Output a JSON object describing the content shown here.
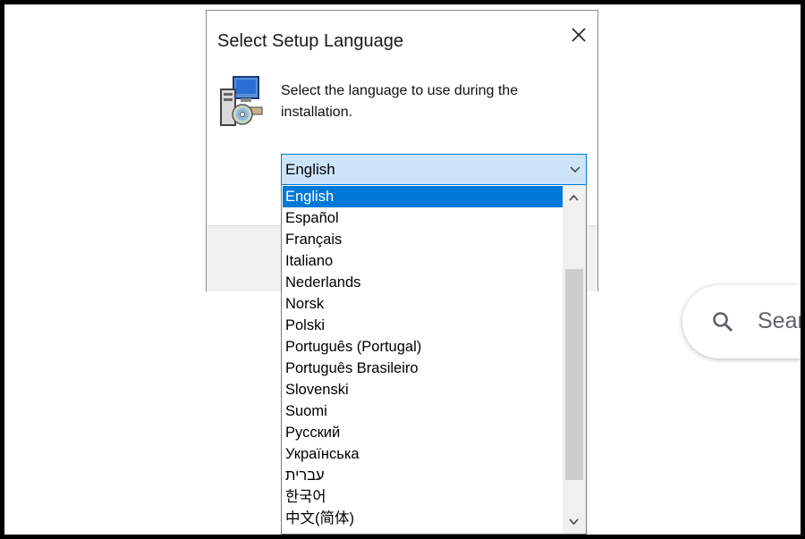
{
  "dialog": {
    "title": "Select Setup Language",
    "message": "Select the language to use during the installation."
  },
  "combobox": {
    "selected": "English"
  },
  "languages": [
    "English",
    "Español",
    "Français",
    "Italiano",
    "Nederlands",
    "Norsk",
    "Polski",
    "Português (Portugal)",
    "Português Brasileiro",
    "Slovenski",
    "Suomi",
    "Русский",
    "Українська",
    "עברית",
    "한국어",
    "中文(简体)"
  ],
  "selected_index": 0,
  "search": {
    "text": "Sear"
  },
  "colors": {
    "accent": "#0078d7",
    "combo_bg": "#cce4f7"
  },
  "icons": [
    "close-icon",
    "setup-installer-icon",
    "chevron-down-icon",
    "scroll-up-icon",
    "scroll-down-icon",
    "search-icon"
  ]
}
